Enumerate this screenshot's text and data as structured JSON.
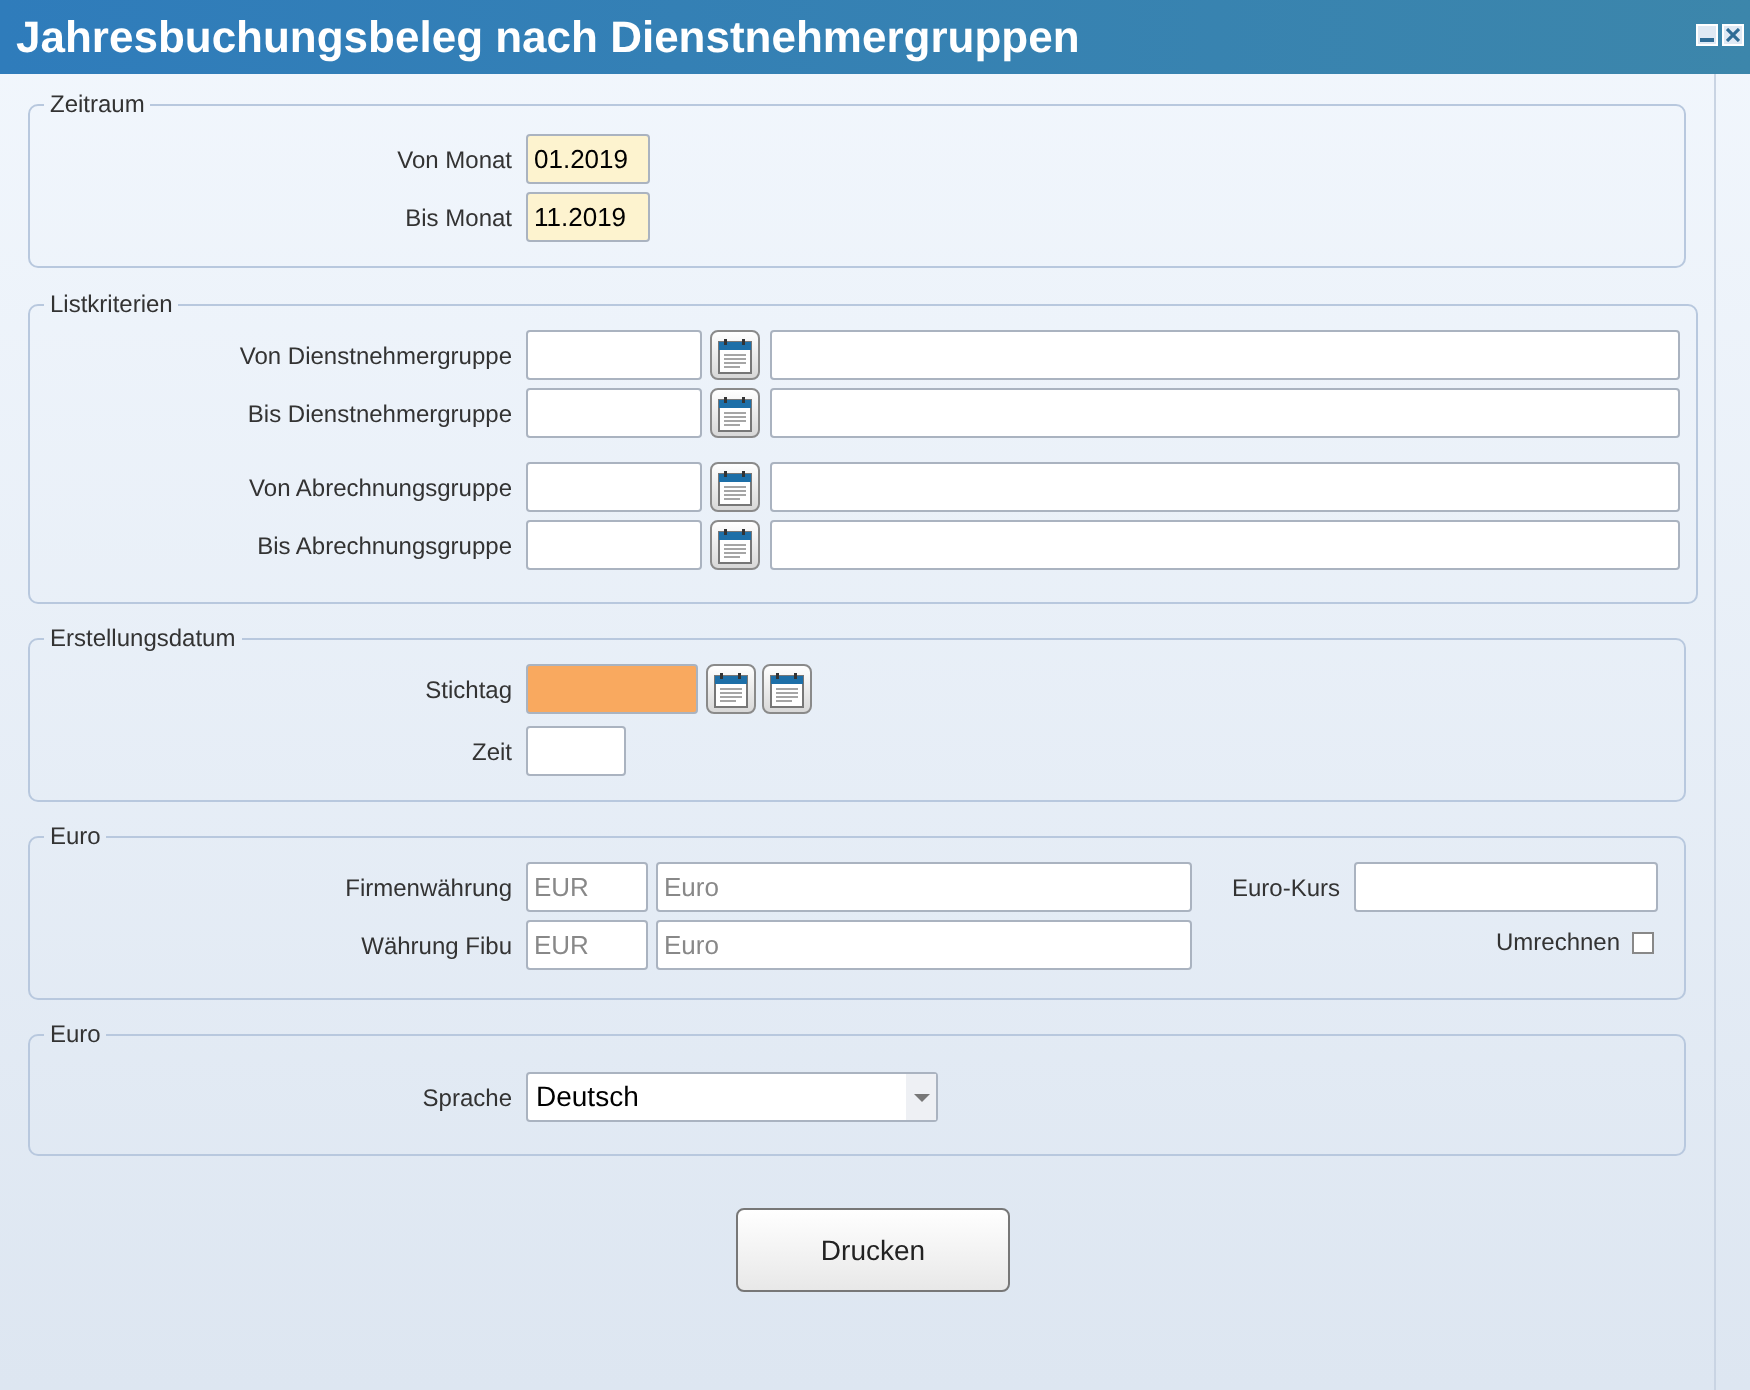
{
  "window": {
    "title": "Jahresbuchungsbeleg nach Dienstnehmergruppen"
  },
  "zeitraum": {
    "legend": "Zeitraum",
    "fields": [
      {
        "label": "Von Monat",
        "value": "01.2019"
      },
      {
        "label": "Bis Monat",
        "value": "11.2019"
      }
    ]
  },
  "listkriterien": {
    "legend": "Listkriterien",
    "groups": [
      [
        {
          "label": "Von Dienstnehmergruppe"
        },
        {
          "label": "Bis Dienstnehmergruppe"
        }
      ],
      [
        {
          "label": "Von Abrechnungsgruppe"
        },
        {
          "label": "Bis Abrechnungsgruppe"
        }
      ]
    ]
  },
  "erstellungsdatum": {
    "legend": "Erstellungsdatum",
    "stichtag": {
      "label": "Stichtag",
      "highlighted": true
    },
    "zeit": {
      "label": "Zeit"
    }
  },
  "euro": {
    "legend": "Euro",
    "currencies": [
      {
        "label": "Firmenwährung",
        "code": "EUR",
        "name": "Euro",
        "disabled": true
      },
      {
        "label": "Währung Fibu",
        "code": "EUR",
        "name": "Euro",
        "disabled": true
      }
    ],
    "kurs": {
      "label": "Euro-Kurs"
    },
    "umrechnen": {
      "label": "Umrechnen",
      "checked": false
    }
  },
  "sprache_section": {
    "legend": "Euro",
    "sprache": {
      "label": "Sprache",
      "value": "Deutsch"
    }
  },
  "buttons": [
    "Drucken"
  ]
}
